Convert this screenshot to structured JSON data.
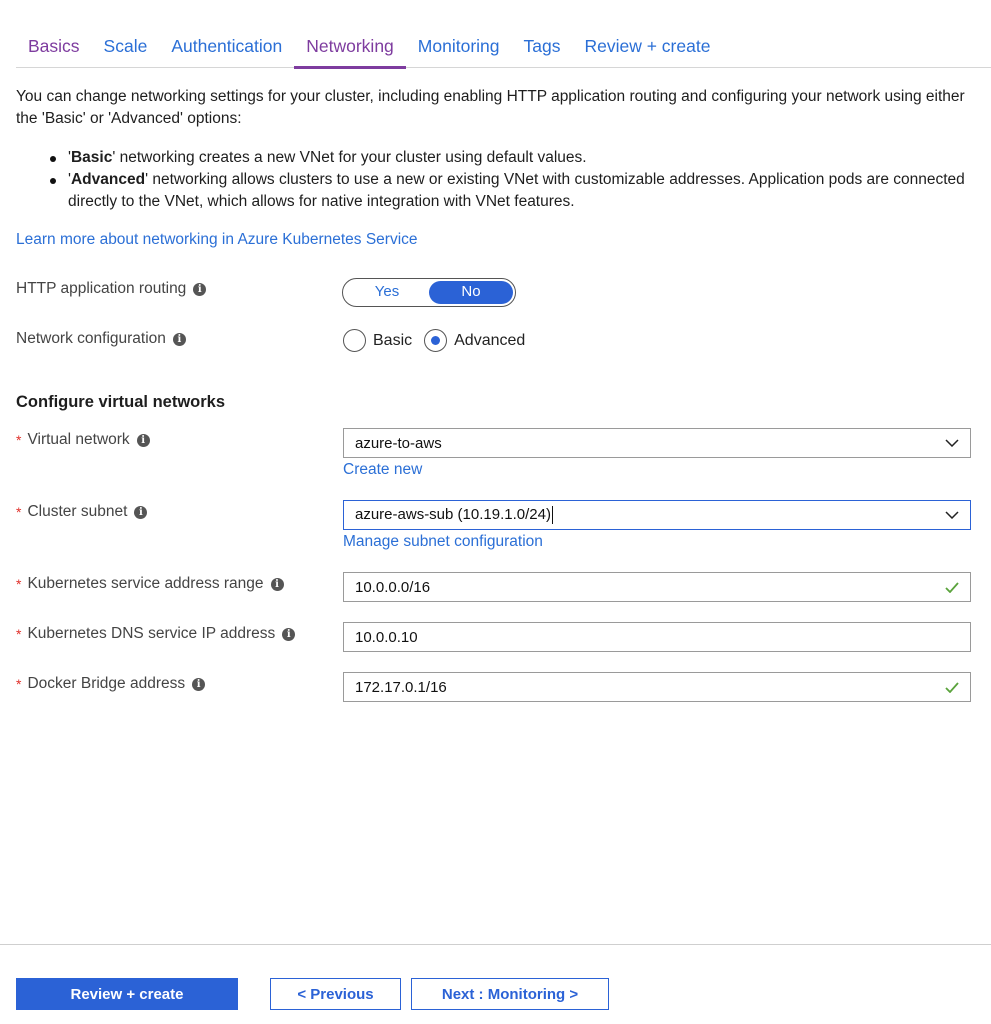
{
  "tabs": [
    {
      "label": "Basics",
      "state": "visited"
    },
    {
      "label": "Scale",
      "state": "default"
    },
    {
      "label": "Authentication",
      "state": "default"
    },
    {
      "label": "Networking",
      "state": "active"
    },
    {
      "label": "Monitoring",
      "state": "default"
    },
    {
      "label": "Tags",
      "state": "default"
    },
    {
      "label": "Review + create",
      "state": "default"
    }
  ],
  "intro": {
    "text": "You can change networking settings for your cluster, including enabling HTTP application routing and configuring your network using either the 'Basic' or 'Advanced' options:",
    "bullets": [
      {
        "open_quote": "'",
        "bold": "Basic",
        "rest": "' networking creates a new VNet for your cluster using default values."
      },
      {
        "open_quote": "'",
        "bold": "Advanced",
        "rest": "' networking allows clusters to use a new or existing VNet with customizable addresses. Application pods are connected directly to the VNet, which allows for native integration with VNet features."
      }
    ],
    "learn_more_link": "Learn more about networking in Azure Kubernetes Service"
  },
  "http_routing": {
    "label": "HTTP application routing",
    "options": [
      "Yes",
      "No"
    ],
    "selected": "No"
  },
  "network_config": {
    "label": "Network configuration",
    "options": [
      "Basic",
      "Advanced"
    ],
    "selected": "Advanced"
  },
  "section_title": "Configure virtual networks",
  "fields": {
    "virtual_network": {
      "label": "Virtual network",
      "value": "azure-to-aws",
      "link": "Create new",
      "required": "*"
    },
    "cluster_subnet": {
      "label": "Cluster subnet",
      "value": "azure-aws-sub (10.19.1.0/24)",
      "link": "Manage subnet configuration",
      "required": "*"
    },
    "service_range": {
      "label": "Kubernetes service address range",
      "value": "10.0.0.0/16",
      "valid": true,
      "required": "*"
    },
    "dns_ip": {
      "label": "Kubernetes DNS service IP address",
      "value": "10.0.0.10",
      "valid": false,
      "required": "*"
    },
    "docker_bridge": {
      "label": "Docker Bridge address",
      "value": "172.17.0.1/16",
      "valid": true,
      "required": "*"
    }
  },
  "footer": {
    "review_create": "Review + create",
    "previous": "< Previous",
    "next": "Next : Monitoring >"
  },
  "colors": {
    "accent": "#2b62d6",
    "link": "#2b6fd6",
    "active_tab": "#7e3c9f",
    "required": "#e0302a",
    "valid_check": "#5aa33c"
  }
}
